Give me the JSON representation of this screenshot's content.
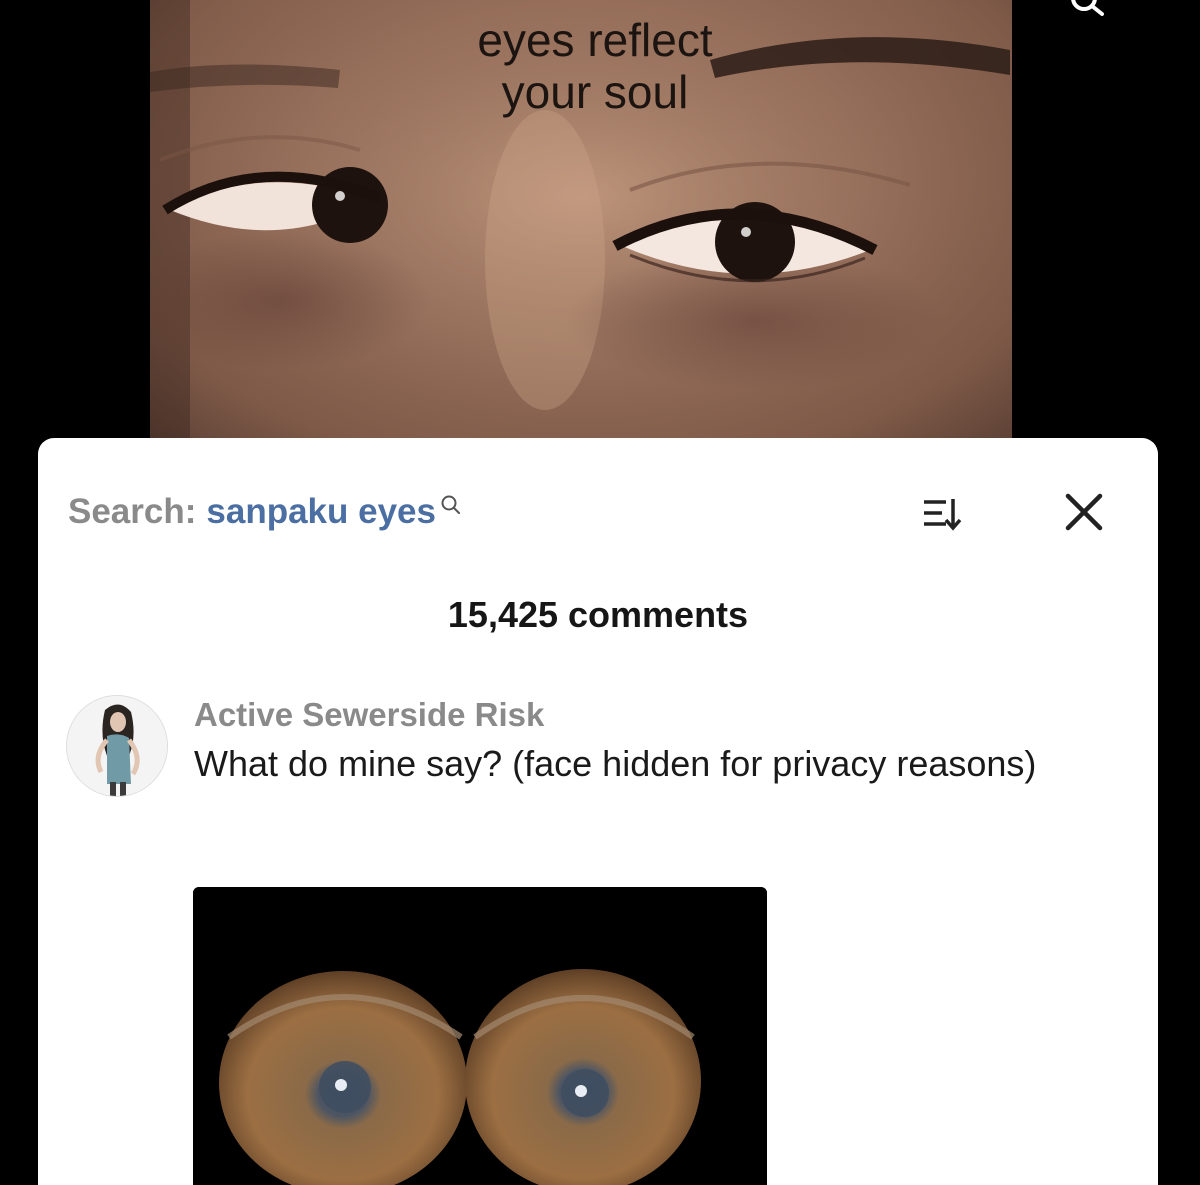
{
  "video": {
    "caption_line1": "eyes reflect",
    "caption_line2": "your soul"
  },
  "comments_panel": {
    "search_label": "Search:",
    "search_term": "sanpaku eyes",
    "comment_count": "15,425 comments",
    "icons": {
      "search": "search-icon",
      "sort": "sort-icon",
      "close": "close-icon"
    }
  },
  "comment": {
    "author": "Active Sewerside Risk",
    "text": "What do mine say? (face hidden for privacy reasons)"
  },
  "colors": {
    "search_term": "#4b6ea3",
    "muted_text": "#8a8a8a",
    "sheet_background": "#ffffff",
    "page_background": "#000000"
  }
}
